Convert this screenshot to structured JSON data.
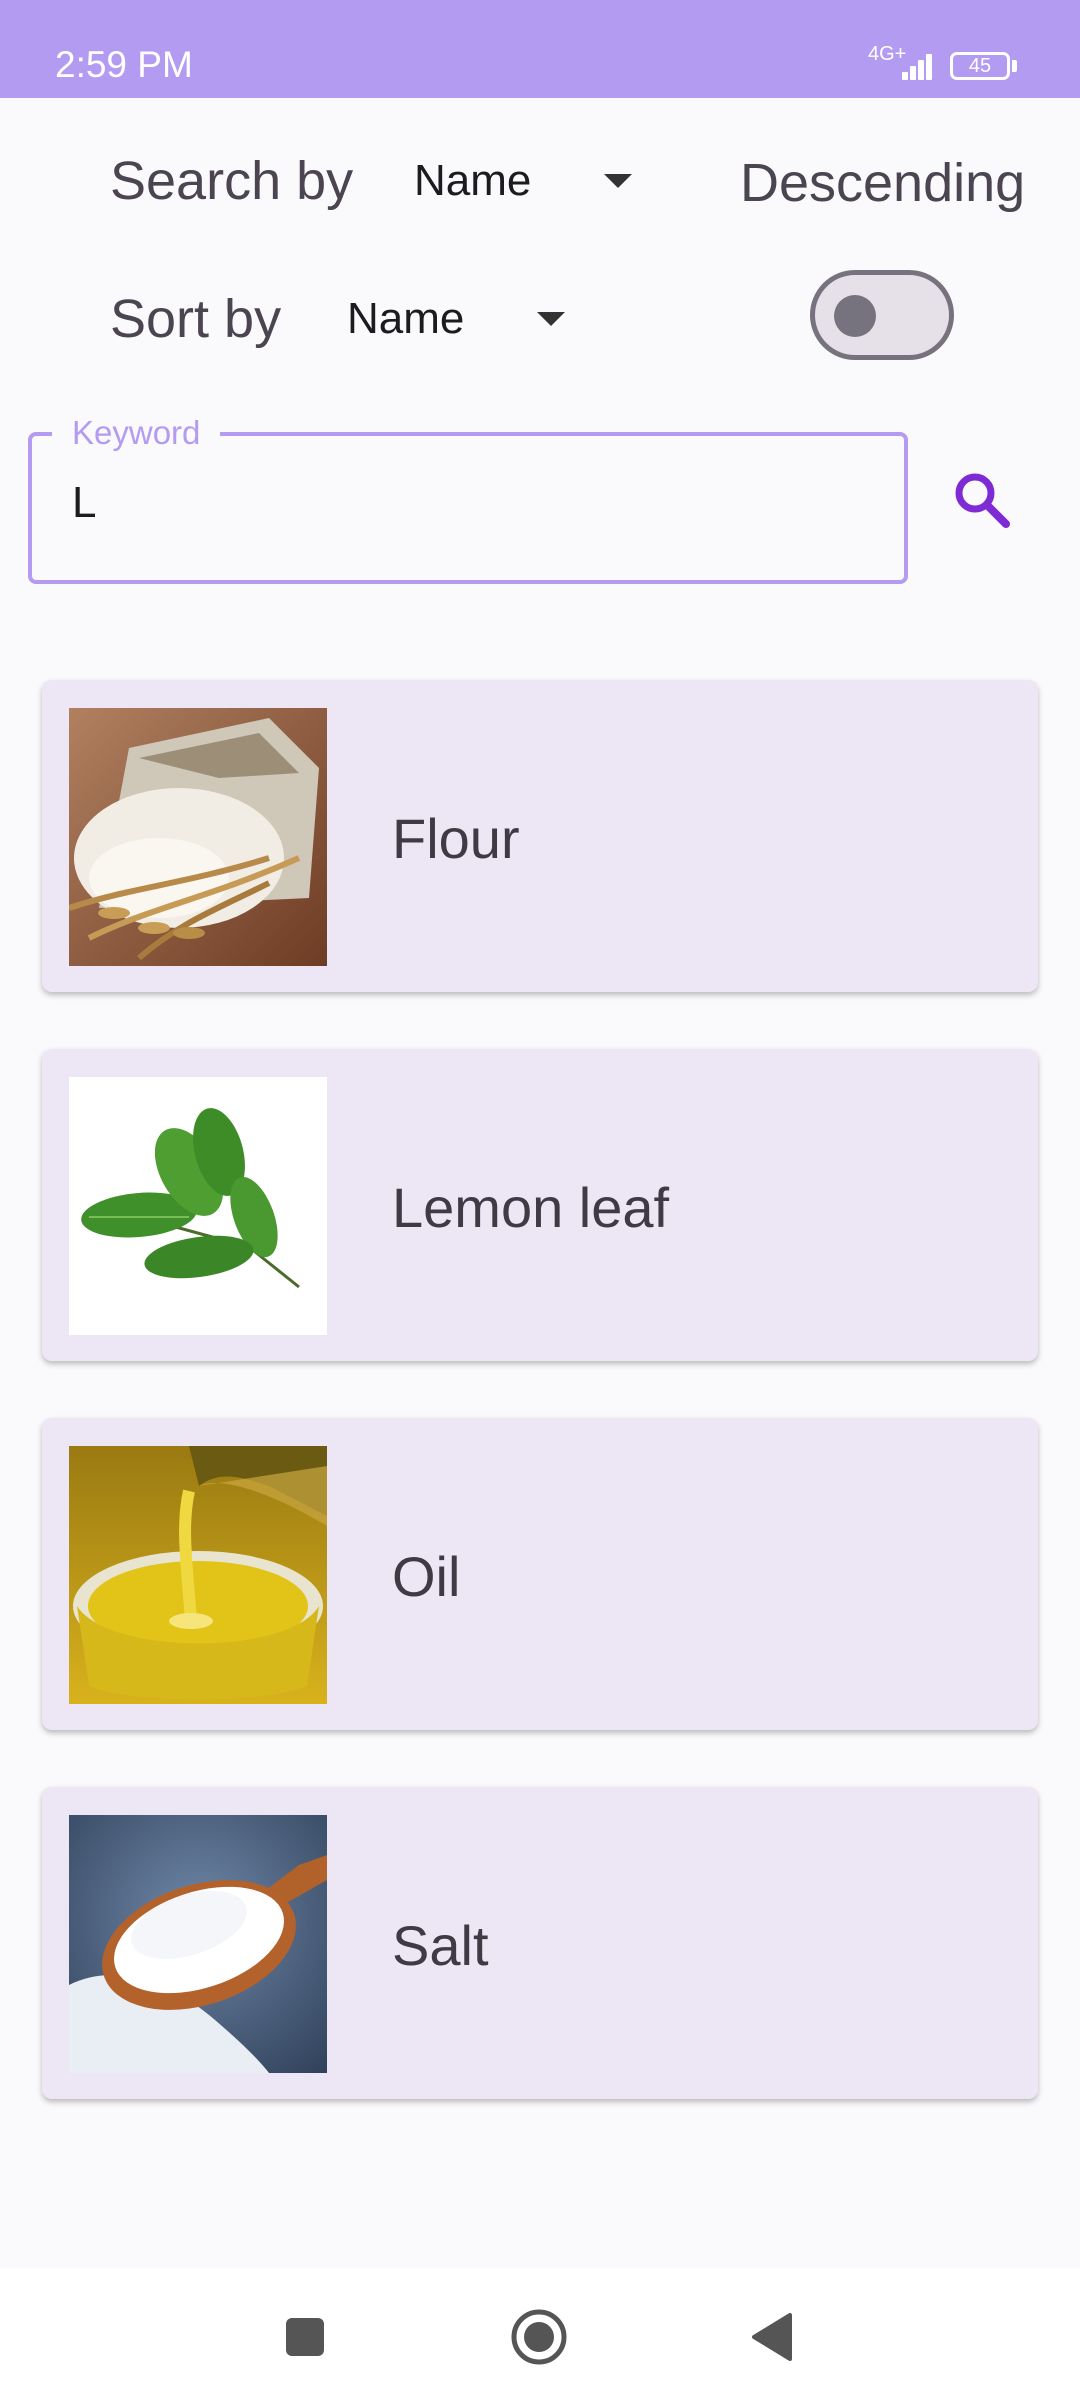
{
  "status_bar": {
    "time": "2:59 PM",
    "network": "4G+",
    "battery": "45"
  },
  "controls": {
    "search_by_label": "Search by",
    "search_by_value": "Name",
    "sort_by_label": "Sort by",
    "sort_by_value": "Name",
    "order_label": "Descending",
    "order_toggle_on": false
  },
  "keyword": {
    "label": "Keyword",
    "value": "L"
  },
  "items": [
    {
      "name": "Flour",
      "image": "flour-photo"
    },
    {
      "name": "Lemon leaf",
      "image": "lemon-leaf-photo"
    },
    {
      "name": "Oil",
      "image": "oil-photo"
    },
    {
      "name": "Salt",
      "image": "salt-photo"
    }
  ],
  "colors": {
    "accent": "#b39bf2",
    "search_icon": "#7e2bd6",
    "card_bg": "#ede6f5"
  },
  "nav_bar": {
    "icons": [
      "recents-square-icon",
      "home-circle-icon",
      "back-triangle-icon"
    ]
  }
}
